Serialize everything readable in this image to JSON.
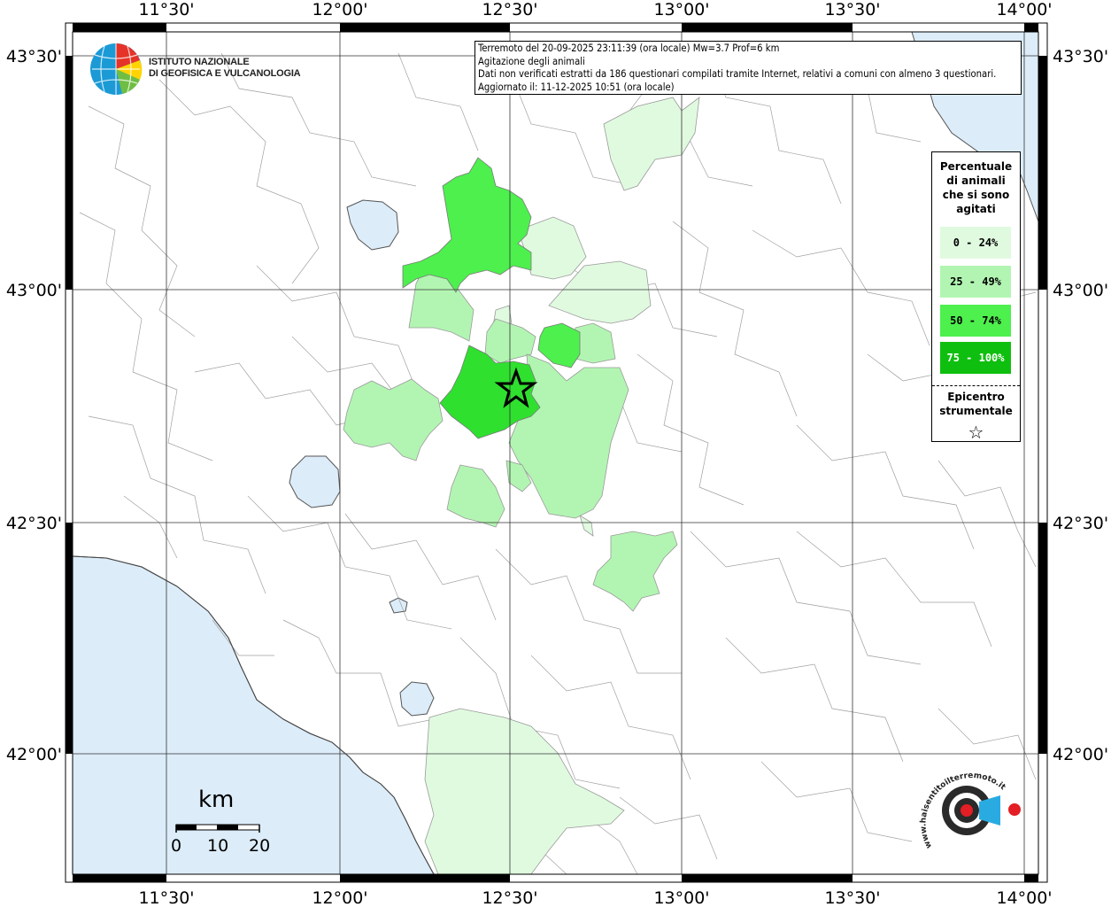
{
  "map": {
    "longitude_ticks": [
      "11°30'",
      "12°00'",
      "12°30'",
      "13°00'",
      "13°30'",
      "14°00'"
    ],
    "latitude_ticks": [
      "43°30'",
      "43°00'",
      "42°30'",
      "42°00'"
    ],
    "epicenter": "star"
  },
  "institute": {
    "line1": "ISTITUTO NAZIONALE",
    "line2": "DI GEOFISICA E VULCANOLOGIA"
  },
  "info": {
    "line1": "Terremoto del 20-09-2025 23:11:39 (ora locale) Mw=3.7 Prof=6 km",
    "line2": "Agitazione degli animali",
    "line3": "Dati non verificati estratti da 186 questionari compilati tramite Internet, relativi a comuni con almeno 3 questionari.",
    "line4": "Aggiornato il: 11-12-2025 10:51 (ora locale)"
  },
  "legend": {
    "title_lines": [
      "Percentuale",
      "di animali",
      "che si sono",
      "agitati"
    ],
    "classes": [
      {
        "label": "0 - 24%",
        "color": "#e0fae0"
      },
      {
        "label": "25 - 49%",
        "color": "#b2f5b2"
      },
      {
        "label": "50 - 74%",
        "color": "#4df04d"
      },
      {
        "label": "75 - 100%",
        "color": "#0fbf0f"
      }
    ],
    "epicenter_lines": [
      "Epicentro",
      "strumentale"
    ],
    "epicenter_symbol": "☆"
  },
  "scale": {
    "unit": "km",
    "labels": [
      "0",
      "10",
      "20"
    ]
  },
  "watermark": {
    "text": "www.haisentitoilterremoto.it"
  },
  "colors": {
    "sea": "#dcecf8",
    "lake": "#dcecf8",
    "border": "#9a9a9a"
  }
}
